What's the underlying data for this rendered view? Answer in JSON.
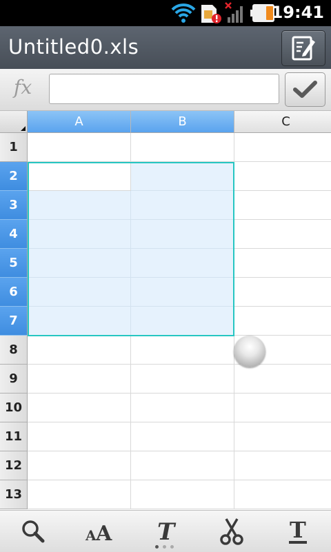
{
  "status_bar": {
    "time": "19:41"
  },
  "app": {
    "title": "Untitled0.xls"
  },
  "formula_bar": {
    "fx_label": "fx",
    "input_value": "",
    "input_placeholder": ""
  },
  "sheet": {
    "columns": [
      "A",
      "B",
      "C"
    ],
    "rows": [
      "1",
      "2",
      "3",
      "4",
      "5",
      "6",
      "7",
      "8",
      "9",
      "10",
      "11",
      "12",
      "13"
    ],
    "selected_range": "A2:B7",
    "active_cell": "A2"
  },
  "toolbar": {
    "items": [
      "search-icon",
      "font-size-icon",
      "italic-icon",
      "cut-icon",
      "underline-icon"
    ],
    "page_indicator": {
      "pages": 3,
      "current": 1
    }
  },
  "colors": {
    "selection_border": "#26c6c2",
    "selected_header": "#5aa3ee",
    "selected_fill": "#e6f2fd"
  }
}
